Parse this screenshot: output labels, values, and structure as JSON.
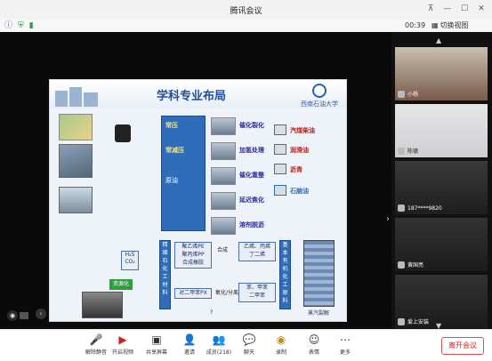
{
  "window": {
    "title": "腾讯会议"
  },
  "status": {
    "timer": "00:39",
    "switch_view": "切换视图"
  },
  "slide": {
    "title": "学科专业布局",
    "university": "西南石油大学",
    "center_labels": [
      "常压",
      "常减压",
      "原油"
    ],
    "process_items": [
      "催化裂化",
      "加氢处理",
      "催化重整",
      "延迟焦化",
      "溶剂脱沥"
    ],
    "products": [
      "汽煤柴油",
      "润滑油",
      "沥青",
      "石脑油"
    ],
    "left_box": "H₂S\nCO₂",
    "green_tag": "资源化",
    "box_polymer": "聚乙烯PE\n聚丙烯PP\n合成橡胶",
    "box_fine": "精\n细\n石\n化\n工\n材\n料",
    "box_basic": "基\n本\n有\n机\n化\n工\n原\n料",
    "box_olefins": "乙烯、丙烯\n丁二烯",
    "box_aromatics": "苯、甲苯\n二甲苯",
    "box_pta": "对二甲苯PX",
    "label_synthesis": "合成",
    "label_oxidation": "氧化/分离",
    "question_mark": "?",
    "cracker_label": "蒸汽裂解"
  },
  "participants": [
    {
      "name": "小杨"
    },
    {
      "name": "陈德"
    },
    {
      "name": "187****9820"
    },
    {
      "name": "黄国亮"
    },
    {
      "name": "爱上安装"
    }
  ],
  "toolbar": {
    "mute": "解除静音",
    "video": "开启视频",
    "share": "共享屏幕",
    "invite": "邀请",
    "members": "成员(218)",
    "chat": "聊天",
    "record": "录制",
    "emoji": "表情",
    "more": "更多",
    "leave": "离开会议"
  },
  "icons": {
    "shield": "shield-icon",
    "signal": "signal-icon",
    "info": "info-icon",
    "colors": {
      "leave": "#e02020",
      "slide_title": "#1f4e9e",
      "green_tag": "#2d9d3e"
    }
  }
}
